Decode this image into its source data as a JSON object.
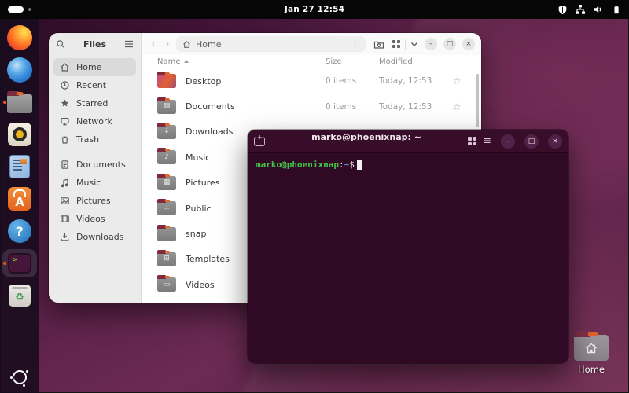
{
  "topbar": {
    "clock": "Jan 27 12:54",
    "right_icons": [
      "shield",
      "network-wired",
      "volume",
      "battery"
    ]
  },
  "dock": {
    "items": [
      {
        "name": "firefox"
      },
      {
        "name": "thunderbird"
      },
      {
        "name": "files",
        "running": true
      },
      {
        "name": "rhythmbox"
      },
      {
        "name": "libreoffice-writer"
      },
      {
        "name": "ubuntu-software",
        "letter": "A"
      },
      {
        "name": "help",
        "glyph": "?"
      },
      {
        "name": "terminal",
        "glyph": ">_",
        "running": true,
        "active": true
      },
      {
        "name": "trash",
        "glyph": "♻"
      }
    ],
    "show_apps": "ubuntu-logo"
  },
  "files": {
    "title": "Files",
    "path_label": "Home",
    "columns": {
      "name": "Name",
      "size": "Size",
      "modified": "Modified"
    },
    "sidebar": [
      {
        "label": "Home",
        "selected": true
      },
      {
        "label": "Recent"
      },
      {
        "label": "Starred"
      },
      {
        "label": "Network"
      },
      {
        "label": "Trash"
      },
      {
        "label": "Documents"
      },
      {
        "label": "Music"
      },
      {
        "label": "Pictures"
      },
      {
        "label": "Videos"
      },
      {
        "label": "Downloads"
      }
    ],
    "rows": [
      {
        "name": "Desktop",
        "size": "0 items",
        "modified": "Today, 12:53",
        "star": "☆",
        "emblem": ""
      },
      {
        "name": "Documents",
        "size": "0 items",
        "modified": "Today, 12:53",
        "star": "☆",
        "emblem": "▤"
      },
      {
        "name": "Downloads",
        "emblem": "↓"
      },
      {
        "name": "Music",
        "emblem": "♪"
      },
      {
        "name": "Pictures",
        "emblem": "▦"
      },
      {
        "name": "Public",
        "emblem": "∴"
      },
      {
        "name": "snap",
        "emblem": ""
      },
      {
        "name": "Templates",
        "emblem": "⊞"
      },
      {
        "name": "Videos",
        "emblem": "▭"
      }
    ]
  },
  "terminal": {
    "title": "marko@phoenixnap: ~",
    "subtitle": "~",
    "prompt": {
      "user": "marko@phoenixnap",
      "colon": ":",
      "path": "~",
      "symbol": "$"
    }
  },
  "desktop": {
    "home_label": "Home"
  },
  "glyphs": {
    "back": "‹",
    "forward": "›",
    "kebab": "⋮",
    "minimize": "–",
    "maximize": "□",
    "close": "×",
    "hamburger": "≡"
  },
  "colors": {
    "accent_orange": "#e95420",
    "terminal_bg": "#300a24",
    "prompt_green": "#43c548",
    "prompt_blue": "#5e8fc7",
    "wallpaper_mid": "#6b2a53",
    "topbar": "#060606"
  }
}
